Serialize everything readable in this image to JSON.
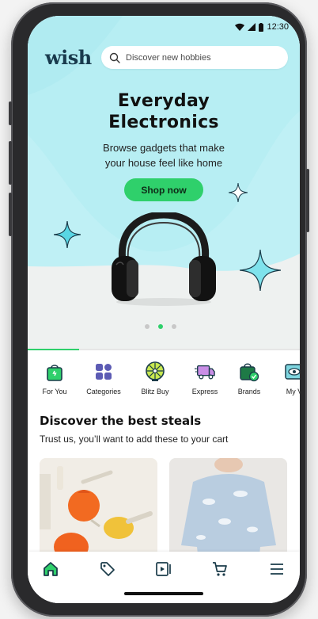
{
  "status_bar": {
    "time": "12:30"
  },
  "header": {
    "logo_text": "wish",
    "search_placeholder": "Discover new hobbies"
  },
  "hero": {
    "title_line1": "Everyday",
    "title_line2": "Electronics",
    "subtitle_line1": "Browse gadgets that make",
    "subtitle_line2": "your house feel like home",
    "cta_label": "Shop now",
    "carousel": {
      "total": 3,
      "active_index": 1
    }
  },
  "tab_scroll_progress": 0.19,
  "categories": [
    {
      "label": "For You",
      "icon": "shopping-bag-icon"
    },
    {
      "label": "Categories",
      "icon": "grid-icon"
    },
    {
      "label": "Blitz Buy",
      "icon": "wheel-icon"
    },
    {
      "label": "Express",
      "icon": "delivery-truck-icon"
    },
    {
      "label": "Brands",
      "icon": "brand-bag-icon"
    },
    {
      "label": "My V",
      "icon": "eye-icon"
    }
  ],
  "section": {
    "title": "Discover the best steals",
    "subtitle": "Trust us, you’ll want to add these to your cart"
  },
  "bottom_nav": [
    {
      "name": "home",
      "icon": "home-icon",
      "active": true
    },
    {
      "name": "deals",
      "icon": "tag-icon",
      "active": false
    },
    {
      "name": "videos",
      "icon": "video-icon",
      "active": false
    },
    {
      "name": "cart",
      "icon": "cart-icon",
      "active": false
    },
    {
      "name": "menu",
      "icon": "menu-icon",
      "active": false
    }
  ],
  "colors": {
    "accent_green": "#2fd06b",
    "hero_cyan": "#bff0f5",
    "logo_navy": "#193a4d",
    "category_purple": "#5c5bb4"
  }
}
